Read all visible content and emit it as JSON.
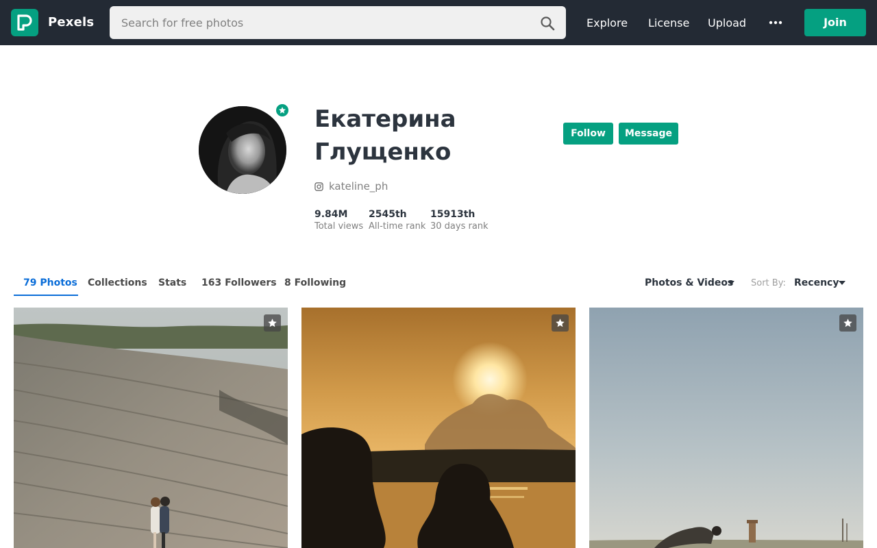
{
  "header": {
    "brand": "Pexels",
    "logo_icon": "pexels-logo-icon",
    "search": {
      "placeholder": "Search for free photos",
      "value": ""
    },
    "nav": {
      "explore": "Explore",
      "license": "License",
      "upload": "Upload"
    },
    "more_icon": "more-horizontal-icon",
    "join_label": "Join",
    "colors": {
      "bar": "#232a34",
      "accent": "#05a081"
    }
  },
  "profile": {
    "name": "Екатерина Глущенко",
    "instagram_handle": "kateline_ph",
    "badge_icon": "star-badge-icon",
    "follow_label": "Follow",
    "message_label": "Message",
    "stats": [
      {
        "value": "9.84M",
        "label": "Total views"
      },
      {
        "value": "2545th",
        "label": "All-time rank"
      },
      {
        "value": "15913th",
        "label": "30 days rank"
      }
    ]
  },
  "tabs": [
    {
      "label": "79 Photos",
      "active": true
    },
    {
      "label": "Collections",
      "active": false
    },
    {
      "label": "Stats",
      "active": false
    },
    {
      "label": "163 Followers",
      "active": false
    },
    {
      "label": "8 Following",
      "active": false
    }
  ],
  "filters": {
    "media_type": "Photos & Videos",
    "sort_label": "Sort By:",
    "sort_value": "Recency"
  },
  "photos": [
    {
      "subject": "couple-on-rocky-hillside",
      "action_icon": "star-icon"
    },
    {
      "subject": "couple-silhouette-sunset-lake",
      "action_icon": "star-icon"
    },
    {
      "subject": "person-lying-on-snowy-field",
      "action_icon": "star-icon"
    }
  ]
}
